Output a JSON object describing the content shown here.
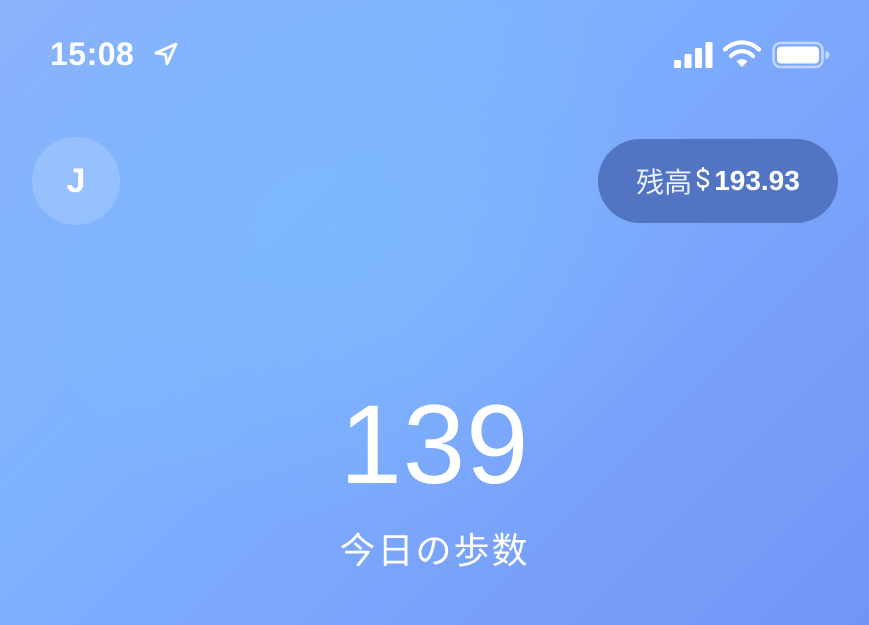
{
  "status_bar": {
    "time": "15:08",
    "icons": [
      "location-arrow-icon",
      "cellular-signal-icon",
      "wifi-icon",
      "battery-icon"
    ]
  },
  "header": {
    "avatar_initial": "J",
    "balance_label": "残高",
    "balance_currency_icon": "currency-icon",
    "balance_value": "193.93"
  },
  "main": {
    "steps_count": "139",
    "steps_label": "今日の歩数"
  },
  "colors": {
    "background_start": "#8ab3fb",
    "background_end": "#7294f6",
    "pill_background": "#5274c2",
    "text": "#ffffff"
  }
}
